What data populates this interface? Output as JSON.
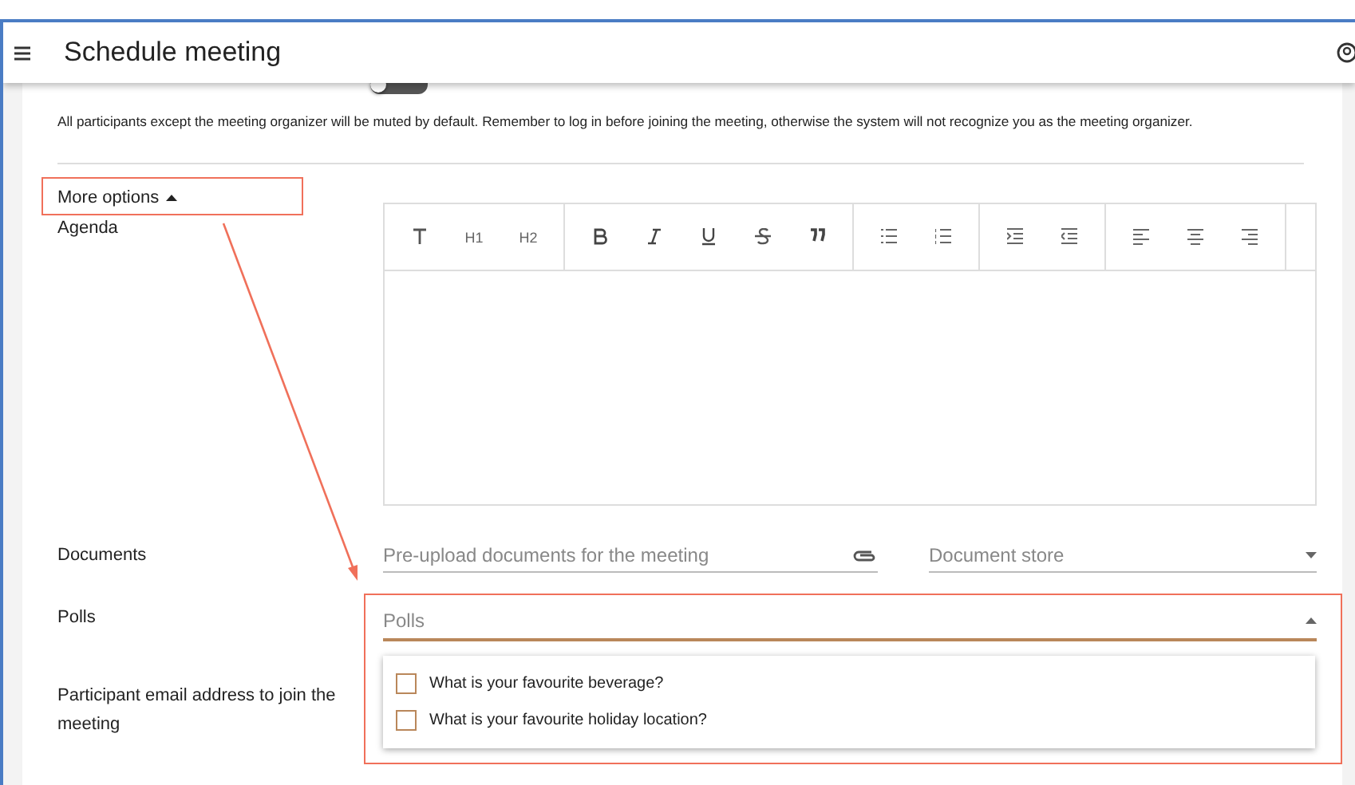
{
  "header": {
    "title": "Schedule meeting"
  },
  "mute_toggle": {
    "on": false
  },
  "mute_note": "All participants except the meeting organizer will be muted by default. Remember to log in before joining the meeting, otherwise the system will not recognize you as the meeting organizer.",
  "more_options": {
    "label": "More options",
    "expanded": true
  },
  "agenda": {
    "label": "Agenda",
    "toolbar": [
      [
        {
          "kind": "text"
        },
        {
          "kind": "heading",
          "label": "H1"
        },
        {
          "kind": "heading",
          "label": "H2"
        }
      ],
      [
        {
          "kind": "bold"
        },
        {
          "kind": "italic"
        },
        {
          "kind": "underline"
        },
        {
          "kind": "strike"
        },
        {
          "kind": "quote"
        }
      ],
      [
        {
          "kind": "ul"
        },
        {
          "kind": "ol"
        }
      ],
      [
        {
          "kind": "indent"
        },
        {
          "kind": "outdent"
        }
      ],
      [
        {
          "kind": "left"
        },
        {
          "kind": "center"
        },
        {
          "kind": "right"
        }
      ]
    ]
  },
  "documents": {
    "label": "Documents",
    "placeholder": "Pre-upload documents for the meeting",
    "store_placeholder": "Document store"
  },
  "polls": {
    "label": "Polls",
    "placeholder": "Polls",
    "expanded": true,
    "options": [
      {
        "label": "What is your favourite beverage?",
        "checked": false
      },
      {
        "label": "What is your favourite holiday location?",
        "checked": false
      }
    ]
  },
  "email": {
    "label": "Participant email address to join the meeting"
  }
}
